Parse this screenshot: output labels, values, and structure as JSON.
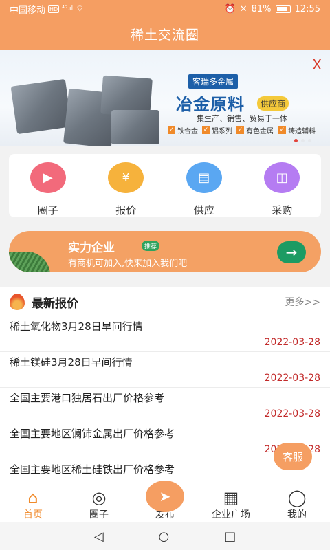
{
  "status": {
    "carrier": "中国移动",
    "hd": "HD",
    "signal": "⁴ᴳ.ıl",
    "battery": "81%",
    "time": "12:55"
  },
  "title": "稀土交流圈",
  "banner": {
    "close": "X",
    "tag": "客瑞多金属",
    "headline": "冶金原料",
    "supplier": "供应商",
    "subline": "集生产、销售、贸易于一体",
    "features": [
      "铁合金",
      "铝系列",
      "有色金属",
      "铸造辅料"
    ]
  },
  "quicklinks": [
    {
      "label": "圈子",
      "icon": "circle-icon",
      "color": "#f26a7b"
    },
    {
      "label": "报价",
      "icon": "quote-icon",
      "color": "#f6b23c"
    },
    {
      "label": "供应",
      "icon": "store-icon",
      "color": "#5aa7f2"
    },
    {
      "label": "采购",
      "icon": "bag-icon",
      "color": "#b57cf2"
    }
  ],
  "promo": {
    "title": "实力企业",
    "badge": "推荐",
    "desc": "有商机可加入,快来加入我们吧",
    "arrow": "→"
  },
  "news": {
    "heading": "最新报价",
    "more": "更多>>",
    "items": [
      {
        "title": "稀土氧化物3月28日早间行情",
        "date": "2022-03-28"
      },
      {
        "title": "稀土镁硅3月28日早间行情",
        "date": "2022-03-28"
      },
      {
        "title": "全国主要港口独居石出厂价格参考",
        "date": "2022-03-28"
      },
      {
        "title": "全国主要地区镧铈金属出厂价格参考",
        "date": "2022-03-28"
      },
      {
        "title": "全国主要地区稀土硅铁出厂价格参考",
        "date": ""
      }
    ]
  },
  "service": "客服",
  "tabs": [
    {
      "label": "首页",
      "icon": "home-icon",
      "glyph": "⌂"
    },
    {
      "label": "圈子",
      "icon": "circle-icon",
      "glyph": "◎"
    },
    {
      "label": "发布",
      "icon": "send-icon",
      "glyph": "➤"
    },
    {
      "label": "企业广场",
      "icon": "building-icon",
      "glyph": "▦"
    },
    {
      "label": "我的",
      "icon": "user-icon",
      "glyph": "◯"
    }
  ],
  "nav": {
    "back": "◁",
    "home": "○",
    "recent": "□"
  },
  "colors": {
    "accent": "#f59e62",
    "date": "#c22a2a",
    "go": "#1c9b63"
  }
}
